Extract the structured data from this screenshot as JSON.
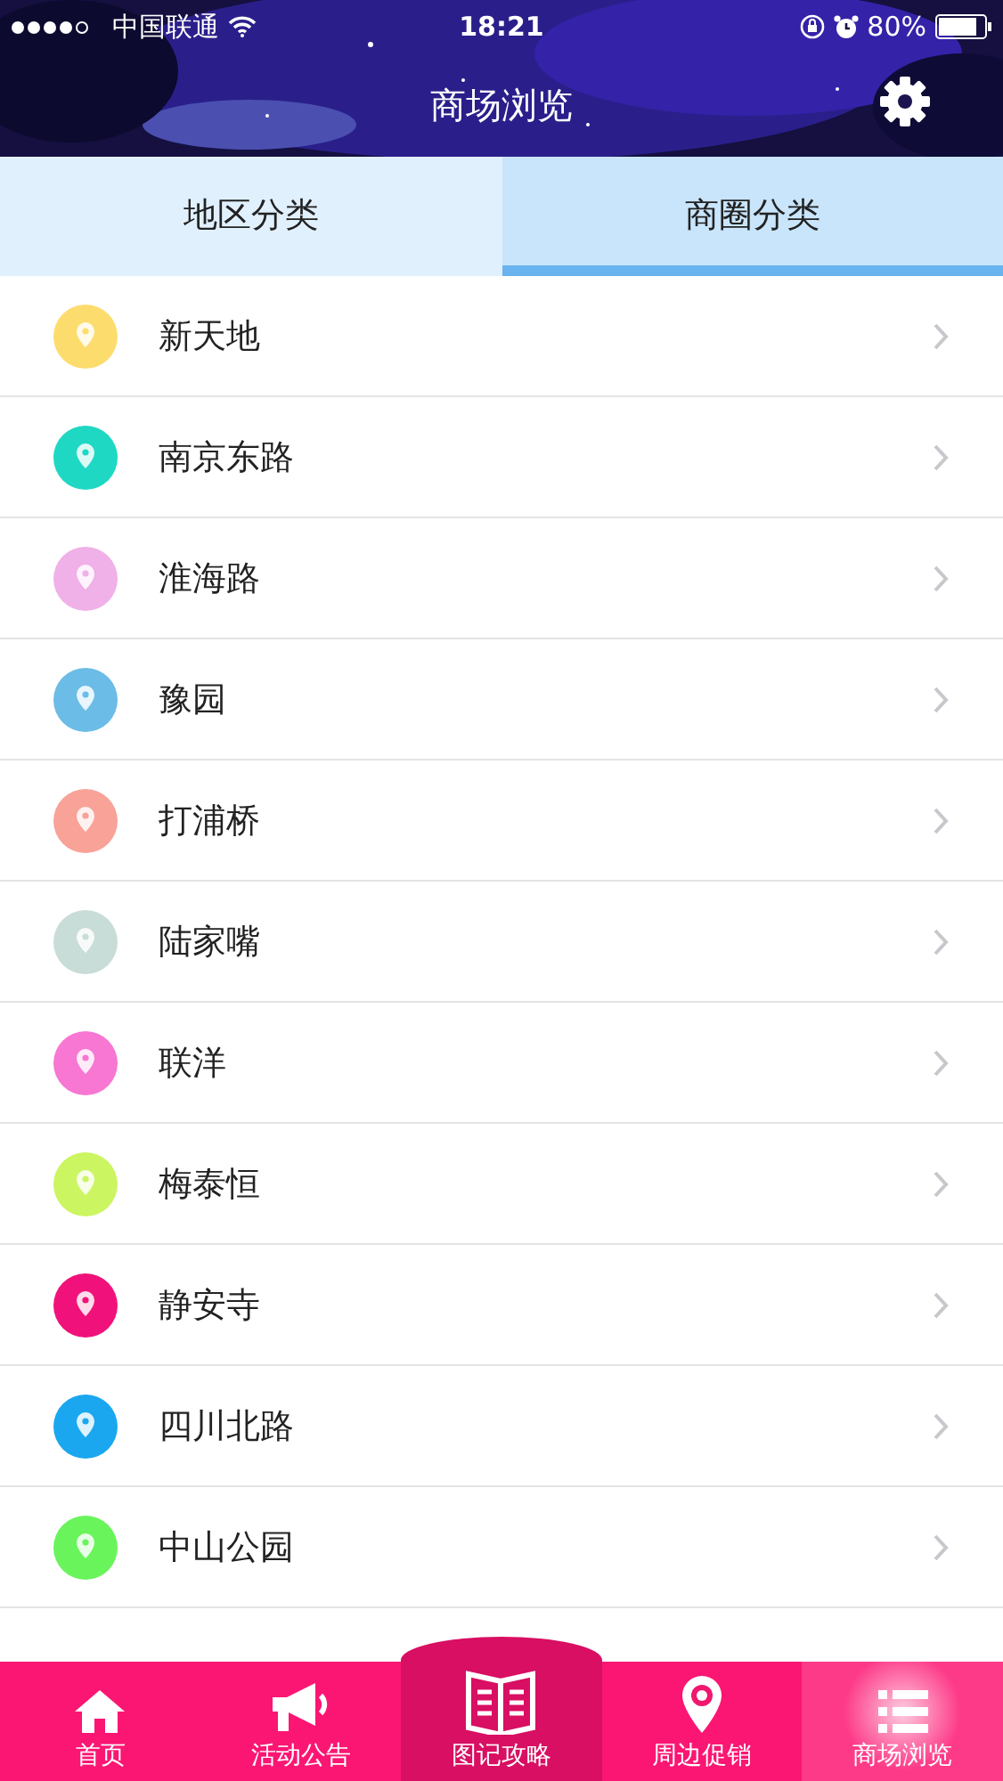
{
  "status_bar": {
    "carrier": "中国联通",
    "time": "18:21",
    "battery": "80%"
  },
  "header": {
    "title": "商场浏览"
  },
  "tabs": [
    {
      "label": "地区分类",
      "selected": false
    },
    {
      "label": "商圈分类",
      "selected": true
    }
  ],
  "items": [
    {
      "label": "新天地",
      "color": "#fddc6e"
    },
    {
      "label": "南京东路",
      "color": "#1ed8c4"
    },
    {
      "label": "淮海路",
      "color": "#f0b0e8"
    },
    {
      "label": "豫园",
      "color": "#6bbce6"
    },
    {
      "label": "打浦桥",
      "color": "#f8a298"
    },
    {
      "label": "陆家嘴",
      "color": "#c8dcd8"
    },
    {
      "label": "联洋",
      "color": "#f777d2"
    },
    {
      "label": "梅泰恒",
      "color": "#ccf562"
    },
    {
      "label": "静安寺",
      "color": "#f0127a"
    },
    {
      "label": "四川北路",
      "color": "#1aa7f0"
    },
    {
      "label": "中山公园",
      "color": "#69f45c"
    }
  ],
  "bottom_nav": [
    {
      "label": "首页",
      "kind": "home",
      "selected": false,
      "raised": false
    },
    {
      "label": "活动公告",
      "kind": "megaphone",
      "selected": false,
      "raised": false
    },
    {
      "label": "图记攻略",
      "kind": "book",
      "selected": false,
      "raised": true
    },
    {
      "label": "周边促销",
      "kind": "pin",
      "selected": false,
      "raised": false
    },
    {
      "label": "商场浏览",
      "kind": "list",
      "selected": true,
      "raised": false
    }
  ]
}
